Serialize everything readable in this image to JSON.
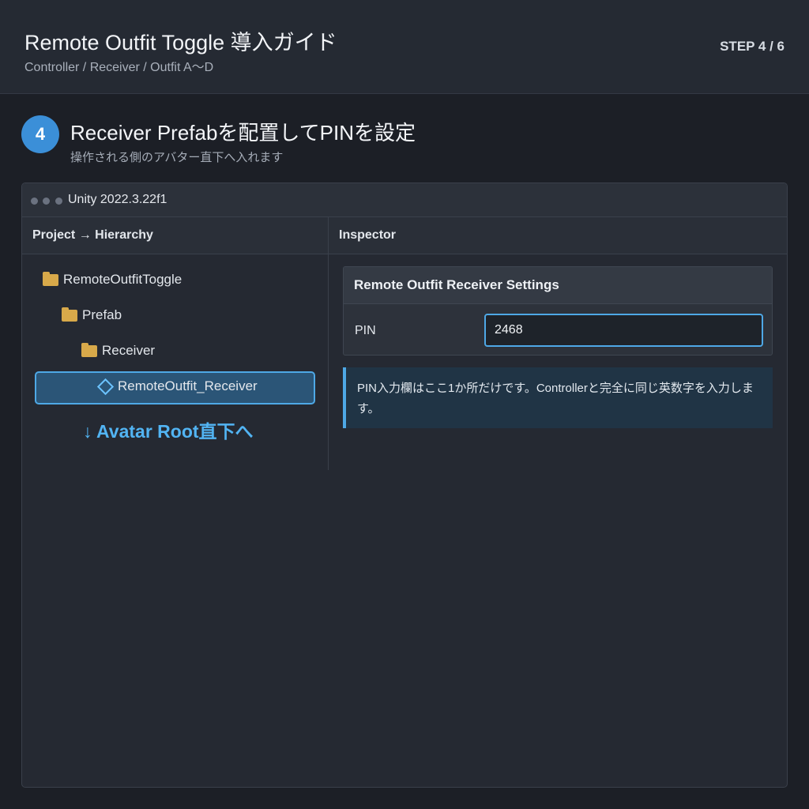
{
  "header": {
    "title": "Remote Outfit Toggle 導入ガイド",
    "subtitle": "Controller / Receiver / Outfit A〜D",
    "step_counter": "STEP 4 / 6"
  },
  "step": {
    "number": "4",
    "title": "Receiver Prefabを配置してPINを設定",
    "description": "操作される側のアバター直下へ入れます"
  },
  "window": {
    "title": "Unity 2022.3.22f1",
    "left_panel": {
      "header": "Project → Hierarchy",
      "tree": [
        {
          "label": "RemoteOutfitToggle",
          "icon": "folder-icon"
        },
        {
          "label": "Prefab",
          "icon": "folder-icon"
        },
        {
          "label": "Receiver",
          "icon": "folder-icon"
        },
        {
          "label": "RemoteOutfit_Receiver",
          "icon": "prefab-icon",
          "selected": true
        }
      ],
      "hint": "↓ Avatar Root直下へ"
    },
    "right_panel": {
      "header": "Inspector",
      "card_title": "Remote Outfit Receiver Settings",
      "pin_label": "PIN",
      "pin_value": "2468",
      "info": "PIN入力欄はここ1か所だけです。Controllerと完全に同じ英数字を入力します。"
    }
  },
  "colors": {
    "accent": "#4ea8e6",
    "badge": "#3b8fd8",
    "folder": "#d8a94a",
    "background": "#1c1f26"
  }
}
